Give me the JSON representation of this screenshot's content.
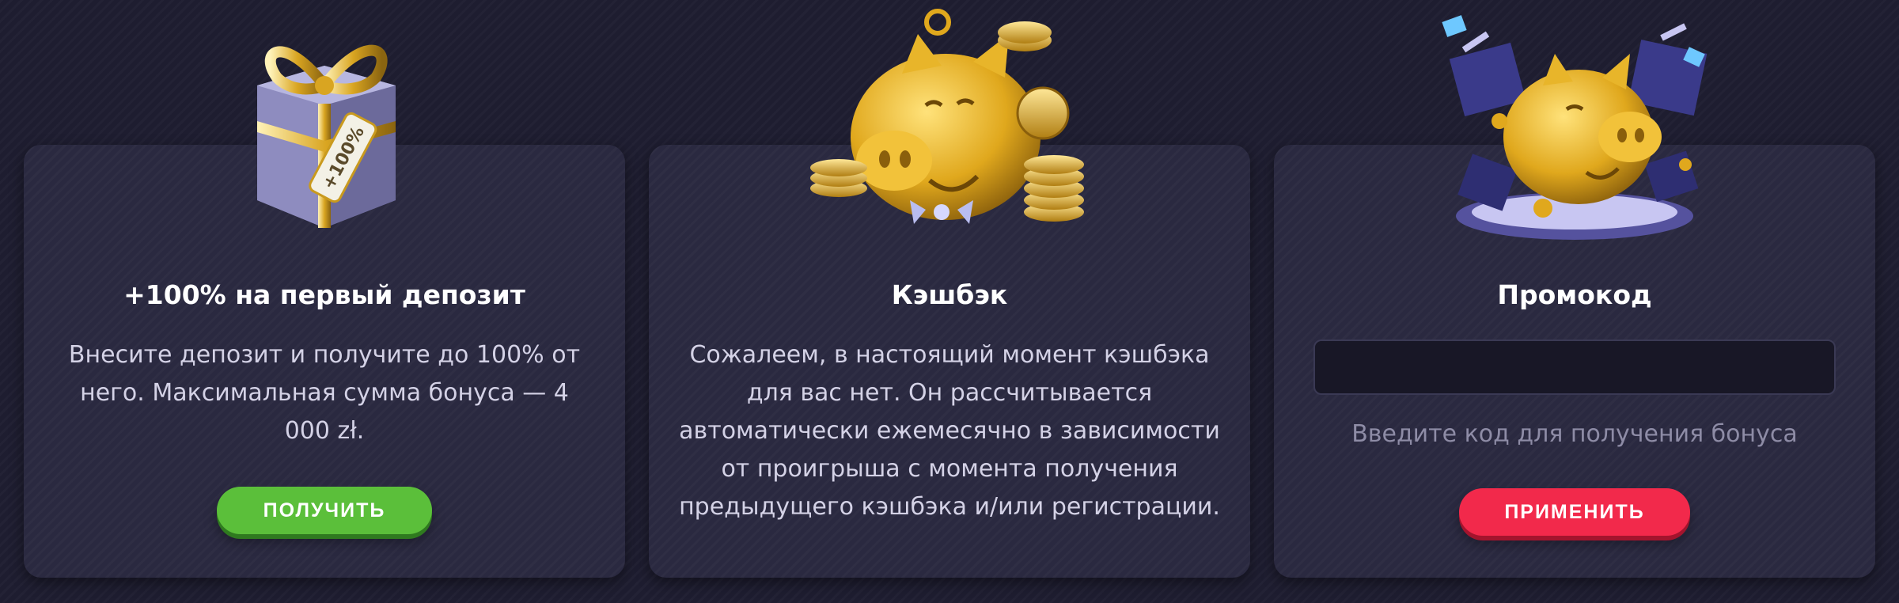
{
  "cards": [
    {
      "title": "+100% на первый депозит",
      "description": "Внесите депозит и получите до 100% от него. Максимальная сумма бонуса — 4 000 zł.",
      "button_label": "ПОЛУЧИТЬ",
      "art": "gift-box-icon",
      "art_tag_text": "+100%"
    },
    {
      "title": "Кэшбэк",
      "description": "Сожалеем, в настоящий момент кэшбэка для вас нет. Он рассчитывается автоматически ежемесячно в зависимости от проигрыша с момента получения предыдущего кэшбэка и/или регистрации.",
      "art": "piggy-bank-coins-icon"
    },
    {
      "title": "Промокод",
      "input_value": "",
      "hint": "Введите код для получения бонуса",
      "button_label": "ПРИМЕНИТЬ",
      "art": "piggy-bank-gifts-icon"
    }
  ],
  "colors": {
    "background": "#1e1d30",
    "card": "#2a2940",
    "get_button": "#5bbf3a",
    "apply_button": "#f2294b",
    "gold": "#e3b021"
  }
}
